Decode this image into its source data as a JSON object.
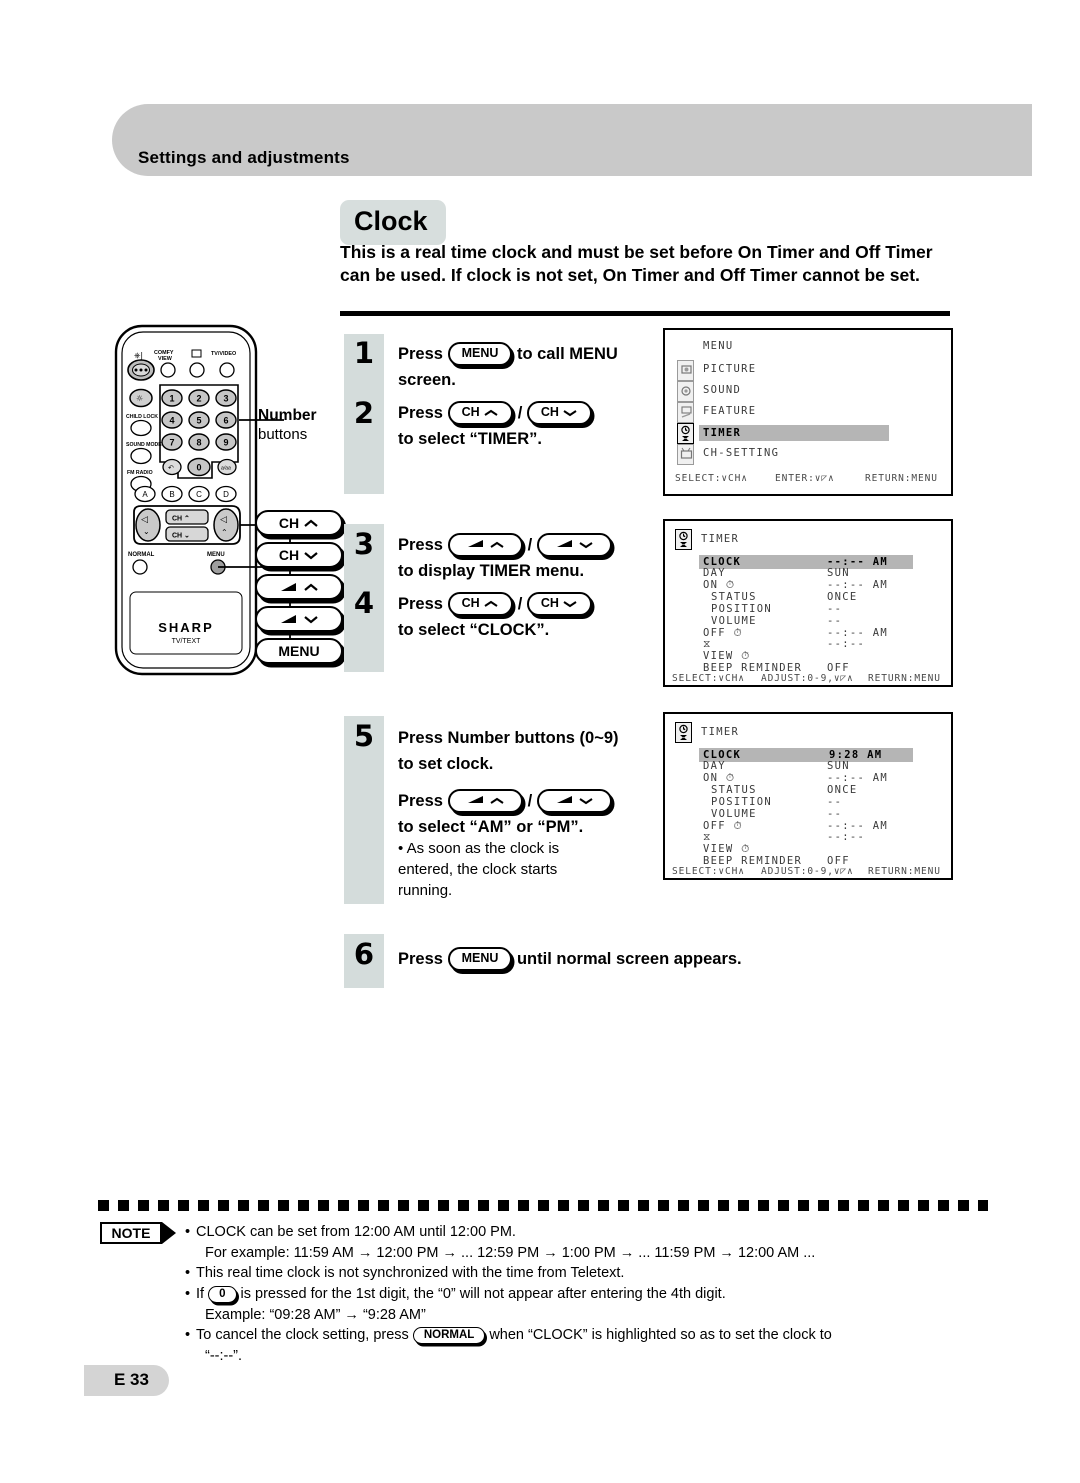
{
  "header": {
    "section_title": "Settings and adjustments"
  },
  "heading": {
    "chip": "Clock",
    "intro": "This is a real time clock and must be set before On Timer and Off Timer can be used. If clock is not set, On Timer and Off Timer cannot be set."
  },
  "remote": {
    "brand": "SHARP",
    "brand_sub": "TV/TEXT",
    "top_labels": [
      "COMFY VIEW",
      "TV/VIDEO"
    ],
    "side_labels": [
      "CHILD LOCK",
      "SOUND MODE",
      "FM RADIO"
    ],
    "number_keys": [
      "1",
      "2",
      "3",
      "4",
      "5",
      "6",
      "7",
      "8",
      "9",
      "0"
    ],
    "letter_keys": [
      "A",
      "B",
      "C",
      "D"
    ],
    "ch_up": "CH",
    "ch_down": "CH",
    "normal_label": "NORMAL",
    "menu_label": "MENU"
  },
  "callouts": {
    "number_buttons_label": "Number",
    "number_buttons_sub": "buttons",
    "buttons": [
      {
        "name": "ch-up",
        "label": "CH",
        "arrow": "up"
      },
      {
        "name": "ch-down",
        "label": "CH",
        "arrow": "down"
      },
      {
        "name": "volume-up",
        "label": "",
        "arrow": "up"
      },
      {
        "name": "volume-down",
        "label": "",
        "arrow": "down"
      },
      {
        "name": "menu",
        "label": "MENU",
        "arrow": "none"
      }
    ]
  },
  "steps": [
    {
      "number": "1",
      "line1_pre": "Press",
      "button": "MENU",
      "line1_post": "to call MENU",
      "line2": "screen."
    },
    {
      "number": "2",
      "line1_pre": "Press",
      "button_a": "CH",
      "sep": "/",
      "button_b": "CH",
      "line2": "to select “TIMER”."
    },
    {
      "number": "3",
      "line1_pre": "Press",
      "sep": "/",
      "line2": "to display TIMER menu."
    },
    {
      "number": "4",
      "line1_pre": "Press",
      "button_a": "CH",
      "sep": "/",
      "button_b": "CH",
      "line2": "to select “CLOCK”."
    },
    {
      "number": "5",
      "line1": "Press Number buttons (0~9)",
      "line2": "to set clock.",
      "line3_pre": "Press",
      "sep": "/",
      "line4": "to select “AM” or “PM”.",
      "sub": "• As soon as the clock is\n  entered, the clock starts\n  running."
    },
    {
      "number": "6",
      "line1_pre": "Press",
      "button": "MENU",
      "line1_post": "until normal screen appears."
    }
  ],
  "osd_menu": {
    "title": "MENU",
    "items": [
      "PICTURE",
      "SOUND",
      "FEATURE",
      "TIMER",
      "CH-SETTING"
    ],
    "highlighted": "TIMER",
    "hints": [
      "SELECT:∨CH∧",
      "ENTER:∨◸∧",
      "RETURN:MENU"
    ]
  },
  "osd_timer_empty": {
    "title": "TIMER",
    "rows": [
      {
        "label": "CLOCK",
        "value": "--:-- AM",
        "highlight": true,
        "indent": 0
      },
      {
        "label": "DAY",
        "value": "SUN",
        "highlight": false,
        "indent": 0
      },
      {
        "label": "ON ⏱",
        "value": "--:-- AM",
        "highlight": false,
        "indent": 0
      },
      {
        "label": "STATUS",
        "value": "ONCE",
        "highlight": false,
        "indent": 1
      },
      {
        "label": "POSITION",
        "value": "--",
        "highlight": false,
        "indent": 1
      },
      {
        "label": "VOLUME",
        "value": "--",
        "highlight": false,
        "indent": 1
      },
      {
        "label": "OFF ⏱",
        "value": "--:-- AM",
        "highlight": false,
        "indent": 0
      },
      {
        "label": "⧖",
        "value": "--:--",
        "highlight": false,
        "indent": 0
      },
      {
        "label": "VIEW ⏱",
        "value": "",
        "highlight": false,
        "indent": 0
      },
      {
        "label": "BEEP REMINDER",
        "value": "OFF",
        "highlight": false,
        "indent": 0
      }
    ],
    "hints": [
      "SELECT:∨CH∧",
      "ADJUST:0-9,∨◸∧",
      "RETURN:MENU"
    ]
  },
  "osd_timer_set": {
    "title": "TIMER",
    "rows": [
      {
        "label": "CLOCK",
        "value": "9:28 AM",
        "highlight": true,
        "indent": 0
      },
      {
        "label": "DAY",
        "value": "SUN",
        "highlight": false,
        "indent": 0
      },
      {
        "label": "ON ⏱",
        "value": "--:-- AM",
        "highlight": false,
        "indent": 0
      },
      {
        "label": "STATUS",
        "value": "ONCE",
        "highlight": false,
        "indent": 1
      },
      {
        "label": "POSITION",
        "value": "--",
        "highlight": false,
        "indent": 1
      },
      {
        "label": "VOLUME",
        "value": "--",
        "highlight": false,
        "indent": 1
      },
      {
        "label": "OFF ⏱",
        "value": "--:-- AM",
        "highlight": false,
        "indent": 0
      },
      {
        "label": "⧖",
        "value": "--:--",
        "highlight": false,
        "indent": 0
      },
      {
        "label": "VIEW ⏱",
        "value": "",
        "highlight": false,
        "indent": 0
      },
      {
        "label": "BEEP REMINDER",
        "value": "OFF",
        "highlight": false,
        "indent": 0
      }
    ],
    "hints": [
      "SELECT:∨CH∧",
      "ADJUST:0-9,∨◸∧",
      "RETURN:MENU"
    ]
  },
  "note": {
    "chip": "NOTE",
    "items": [
      {
        "text": "CLOCK can be set from 12:00 AM until 12:00 PM.",
        "cont": "For example: 11:59 AM → 12:00 PM → ... 12:59 PM → 1:00 PM → ... 11:59 PM → 12:00 AM ..."
      },
      {
        "text": "This real time clock is not synchronized with the time from Teletext.",
        "cont": ""
      },
      {
        "text_pre": "If",
        "pill": "0",
        "text_post": "is pressed for the 1st digit, the “0” will not appear after entering the 4th digit.",
        "cont": "Example: “09:28 AM” → “9:28 AM”"
      },
      {
        "text_pre": "To cancel the clock setting, press",
        "pill": "NORMAL",
        "text_post": "when “CLOCK” is highlighted so as to set the clock to",
        "cont": "“--:--”."
      }
    ]
  },
  "footer": {
    "page": "E 33"
  },
  "colors": {
    "header_band": "#c9c9c9",
    "chip_bg": "#d7dedd",
    "step_bg": "#d4dcdb",
    "osd_highlight": "#b5b5b5",
    "footer_bg": "#d4d4d4"
  }
}
